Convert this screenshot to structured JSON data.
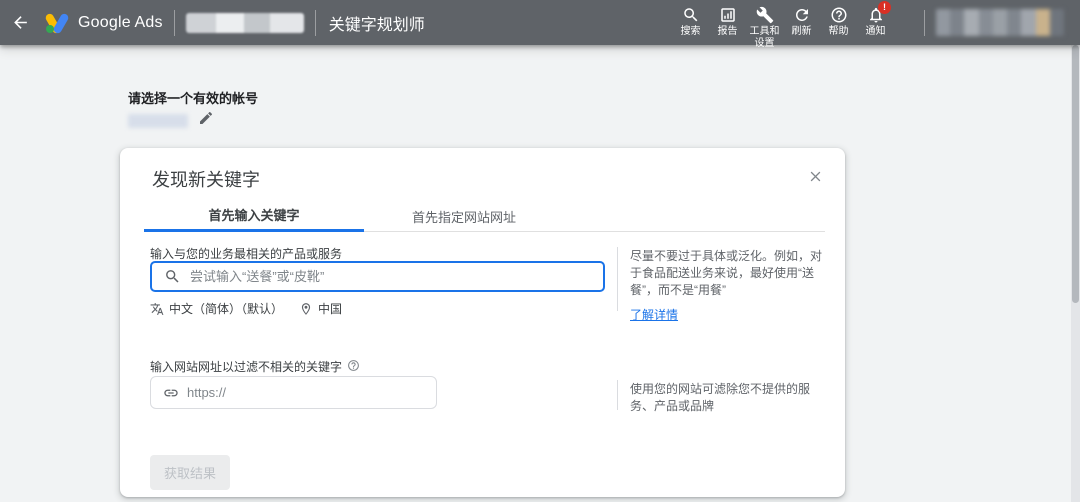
{
  "topbar": {
    "brand": "Google Ads",
    "page_title": "关键字规划师",
    "nav_items": [
      {
        "icon": "search-icon",
        "label": "搜索"
      },
      {
        "icon": "reports-icon",
        "label": "报告"
      },
      {
        "icon": "tools-settings-icon",
        "label": "工具和设置"
      },
      {
        "icon": "refresh-icon",
        "label": "刷新"
      },
      {
        "icon": "help-icon",
        "label": "帮助"
      },
      {
        "icon": "notifications-icon",
        "label": "通知",
        "badge": "!"
      }
    ]
  },
  "account_picker": {
    "heading": "请选择一个有效的帐号"
  },
  "dialog": {
    "title": "发现新关键字",
    "tabs": [
      {
        "label": "首先输入关键字",
        "active": true
      },
      {
        "label": "首先指定网站网址",
        "active": false
      }
    ],
    "keyword_section": {
      "label": "输入与您的业务最相关的产品或服务",
      "placeholder": "尝试输入“送餐”或“皮靴”",
      "language": "中文（简体）（默认）",
      "location": "中国",
      "tip": "尽量不要过于具体或泛化。例如，对于食品配送业务来说，最好使用“送餐”，而不是“用餐”",
      "tip_link": "了解详情"
    },
    "url_section": {
      "label": "输入网站网址以过滤不相关的关键字",
      "placeholder": "https://",
      "tip": "使用您的网站可滤除您不提供的服务、产品或品牌"
    },
    "submit_label": "获取结果"
  },
  "colors": {
    "accent_blue": "#1a73e8",
    "topbar_gray": "#5f6368",
    "badge_red": "#d93025",
    "page_bg": "#f1f3f4"
  }
}
